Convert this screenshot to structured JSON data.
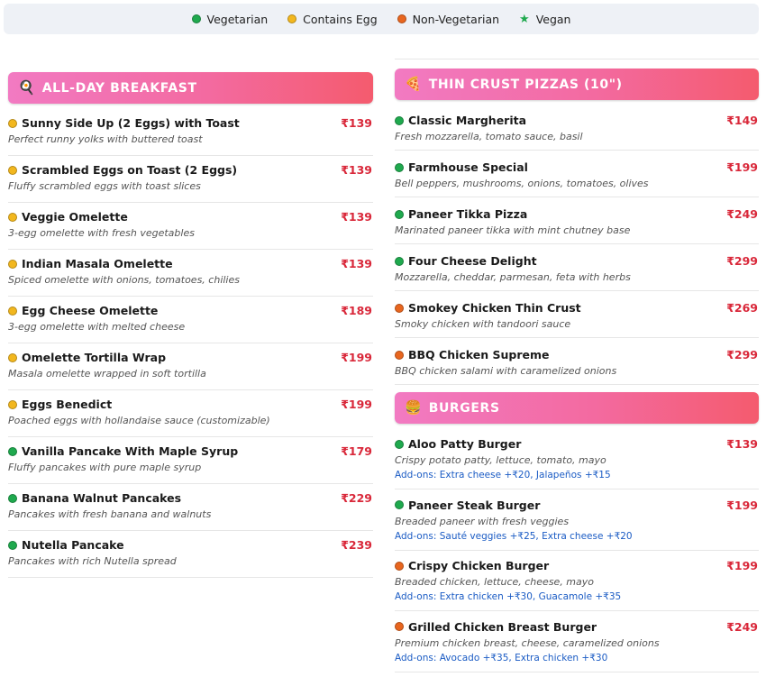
{
  "legend": [
    {
      "label": "Vegetarian",
      "type": "veg"
    },
    {
      "label": "Contains Egg",
      "type": "egg"
    },
    {
      "label": "Non-Vegetarian",
      "type": "nonveg"
    },
    {
      "label": "Vegan",
      "type": "vegan"
    }
  ],
  "sections": {
    "breakfast": {
      "icon": "🍳",
      "title": "ALL-DAY BREAKFAST",
      "items": [
        {
          "name": "Sunny Side Up (2 Eggs) with Toast",
          "price": "₹139",
          "desc": "Perfect runny yolks with buttered toast",
          "diet": "egg"
        },
        {
          "name": "Scrambled Eggs on Toast (2 Eggs)",
          "price": "₹139",
          "desc": "Fluffy scrambled eggs with toast slices",
          "diet": "egg"
        },
        {
          "name": "Veggie Omelette",
          "price": "₹139",
          "desc": "3-egg omelette with fresh vegetables",
          "diet": "egg"
        },
        {
          "name": "Indian Masala Omelette",
          "price": "₹139",
          "desc": "Spiced omelette with onions, tomatoes, chilies",
          "diet": "egg"
        },
        {
          "name": "Egg Cheese Omelette",
          "price": "₹189",
          "desc": "3-egg omelette with melted cheese",
          "diet": "egg"
        },
        {
          "name": "Omelette Tortilla Wrap",
          "price": "₹199",
          "desc": "Masala omelette wrapped in soft tortilla",
          "diet": "egg"
        },
        {
          "name": "Eggs Benedict",
          "price": "₹199",
          "desc": "Poached eggs with hollandaise sauce (customizable)",
          "diet": "egg"
        },
        {
          "name": "Vanilla Pancake With Maple Syrup",
          "price": "₹179",
          "desc": "Fluffy pancakes with pure maple syrup",
          "diet": "veg"
        },
        {
          "name": "Banana Walnut Pancakes",
          "price": "₹229",
          "desc": "Pancakes with fresh banana and walnuts",
          "diet": "veg"
        },
        {
          "name": "Nutella Pancake",
          "price": "₹239",
          "desc": "Pancakes with rich Nutella spread",
          "diet": "veg"
        }
      ]
    },
    "pizzas": {
      "icon": "🍕",
      "title": "THIN CRUST PIZZAS (10\")",
      "items": [
        {
          "name": "Classic Margherita",
          "price": "₹149",
          "desc": "Fresh mozzarella, tomato sauce, basil",
          "diet": "veg"
        },
        {
          "name": "Farmhouse Special",
          "price": "₹199",
          "desc": "Bell peppers, mushrooms, onions, tomatoes, olives",
          "diet": "veg"
        },
        {
          "name": "Paneer Tikka Pizza",
          "price": "₹249",
          "desc": "Marinated paneer tikka with mint chutney base",
          "diet": "veg"
        },
        {
          "name": "Four Cheese Delight",
          "price": "₹299",
          "desc": "Mozzarella, cheddar, parmesan, feta with herbs",
          "diet": "veg"
        },
        {
          "name": "Smokey Chicken Thin Crust",
          "price": "₹269",
          "desc": "Smoky chicken with tandoori sauce",
          "diet": "nonveg"
        },
        {
          "name": "BBQ Chicken Supreme",
          "price": "₹299",
          "desc": "BBQ chicken salami with caramelized onions",
          "diet": "nonveg"
        }
      ]
    },
    "burgers": {
      "icon": "🍔",
      "title": "BURGERS",
      "items": [
        {
          "name": "Aloo Patty Burger",
          "price": "₹139",
          "desc": "Crispy potato patty, lettuce, tomato, mayo",
          "addon": "Add-ons: Extra cheese +₹20, Jalapeños +₹15",
          "diet": "veg"
        },
        {
          "name": "Paneer Steak Burger",
          "price": "₹199",
          "desc": "Breaded paneer with fresh veggies",
          "addon": "Add-ons: Sauté veggies +₹25, Extra cheese +₹20",
          "diet": "veg"
        },
        {
          "name": "Crispy Chicken Burger",
          "price": "₹199",
          "desc": "Breaded chicken, lettuce, cheese, mayo",
          "addon": "Add-ons: Extra chicken +₹30, Guacamole +₹35",
          "diet": "nonveg"
        },
        {
          "name": "Grilled Chicken Breast Burger",
          "price": "₹249",
          "desc": "Premium chicken breast, cheese, caramelized onions",
          "addon": "Add-ons: Avocado +₹35, Extra chicken +₹30",
          "diet": "nonveg"
        }
      ]
    }
  },
  "colors": {
    "veg": "#1fa94e",
    "egg": "#f2b71e",
    "nonveg": "#e8661f",
    "price": "#d9283a",
    "addon": "#1a5bc4"
  }
}
